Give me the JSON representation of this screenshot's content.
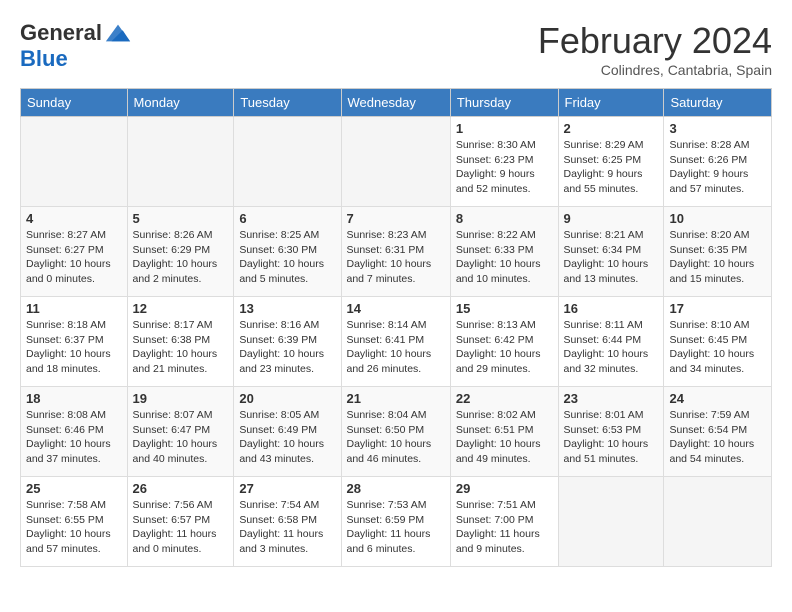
{
  "logo": {
    "general": "General",
    "blue": "Blue"
  },
  "title": "February 2024",
  "subtitle": "Colindres, Cantabria, Spain",
  "days_of_week": [
    "Sunday",
    "Monday",
    "Tuesday",
    "Wednesday",
    "Thursday",
    "Friday",
    "Saturday"
  ],
  "weeks": [
    [
      {
        "day": "",
        "info": ""
      },
      {
        "day": "",
        "info": ""
      },
      {
        "day": "",
        "info": ""
      },
      {
        "day": "",
        "info": ""
      },
      {
        "day": "1",
        "info": "Sunrise: 8:30 AM\nSunset: 6:23 PM\nDaylight: 9 hours and 52 minutes."
      },
      {
        "day": "2",
        "info": "Sunrise: 8:29 AM\nSunset: 6:25 PM\nDaylight: 9 hours and 55 minutes."
      },
      {
        "day": "3",
        "info": "Sunrise: 8:28 AM\nSunset: 6:26 PM\nDaylight: 9 hours and 57 minutes."
      }
    ],
    [
      {
        "day": "4",
        "info": "Sunrise: 8:27 AM\nSunset: 6:27 PM\nDaylight: 10 hours and 0 minutes."
      },
      {
        "day": "5",
        "info": "Sunrise: 8:26 AM\nSunset: 6:29 PM\nDaylight: 10 hours and 2 minutes."
      },
      {
        "day": "6",
        "info": "Sunrise: 8:25 AM\nSunset: 6:30 PM\nDaylight: 10 hours and 5 minutes."
      },
      {
        "day": "7",
        "info": "Sunrise: 8:23 AM\nSunset: 6:31 PM\nDaylight: 10 hours and 7 minutes."
      },
      {
        "day": "8",
        "info": "Sunrise: 8:22 AM\nSunset: 6:33 PM\nDaylight: 10 hours and 10 minutes."
      },
      {
        "day": "9",
        "info": "Sunrise: 8:21 AM\nSunset: 6:34 PM\nDaylight: 10 hours and 13 minutes."
      },
      {
        "day": "10",
        "info": "Sunrise: 8:20 AM\nSunset: 6:35 PM\nDaylight: 10 hours and 15 minutes."
      }
    ],
    [
      {
        "day": "11",
        "info": "Sunrise: 8:18 AM\nSunset: 6:37 PM\nDaylight: 10 hours and 18 minutes."
      },
      {
        "day": "12",
        "info": "Sunrise: 8:17 AM\nSunset: 6:38 PM\nDaylight: 10 hours and 21 minutes."
      },
      {
        "day": "13",
        "info": "Sunrise: 8:16 AM\nSunset: 6:39 PM\nDaylight: 10 hours and 23 minutes."
      },
      {
        "day": "14",
        "info": "Sunrise: 8:14 AM\nSunset: 6:41 PM\nDaylight: 10 hours and 26 minutes."
      },
      {
        "day": "15",
        "info": "Sunrise: 8:13 AM\nSunset: 6:42 PM\nDaylight: 10 hours and 29 minutes."
      },
      {
        "day": "16",
        "info": "Sunrise: 8:11 AM\nSunset: 6:44 PM\nDaylight: 10 hours and 32 minutes."
      },
      {
        "day": "17",
        "info": "Sunrise: 8:10 AM\nSunset: 6:45 PM\nDaylight: 10 hours and 34 minutes."
      }
    ],
    [
      {
        "day": "18",
        "info": "Sunrise: 8:08 AM\nSunset: 6:46 PM\nDaylight: 10 hours and 37 minutes."
      },
      {
        "day": "19",
        "info": "Sunrise: 8:07 AM\nSunset: 6:47 PM\nDaylight: 10 hours and 40 minutes."
      },
      {
        "day": "20",
        "info": "Sunrise: 8:05 AM\nSunset: 6:49 PM\nDaylight: 10 hours and 43 minutes."
      },
      {
        "day": "21",
        "info": "Sunrise: 8:04 AM\nSunset: 6:50 PM\nDaylight: 10 hours and 46 minutes."
      },
      {
        "day": "22",
        "info": "Sunrise: 8:02 AM\nSunset: 6:51 PM\nDaylight: 10 hours and 49 minutes."
      },
      {
        "day": "23",
        "info": "Sunrise: 8:01 AM\nSunset: 6:53 PM\nDaylight: 10 hours and 51 minutes."
      },
      {
        "day": "24",
        "info": "Sunrise: 7:59 AM\nSunset: 6:54 PM\nDaylight: 10 hours and 54 minutes."
      }
    ],
    [
      {
        "day": "25",
        "info": "Sunrise: 7:58 AM\nSunset: 6:55 PM\nDaylight: 10 hours and 57 minutes."
      },
      {
        "day": "26",
        "info": "Sunrise: 7:56 AM\nSunset: 6:57 PM\nDaylight: 11 hours and 0 minutes."
      },
      {
        "day": "27",
        "info": "Sunrise: 7:54 AM\nSunset: 6:58 PM\nDaylight: 11 hours and 3 minutes."
      },
      {
        "day": "28",
        "info": "Sunrise: 7:53 AM\nSunset: 6:59 PM\nDaylight: 11 hours and 6 minutes."
      },
      {
        "day": "29",
        "info": "Sunrise: 7:51 AM\nSunset: 7:00 PM\nDaylight: 11 hours and 9 minutes."
      },
      {
        "day": "",
        "info": ""
      },
      {
        "day": "",
        "info": ""
      }
    ]
  ]
}
